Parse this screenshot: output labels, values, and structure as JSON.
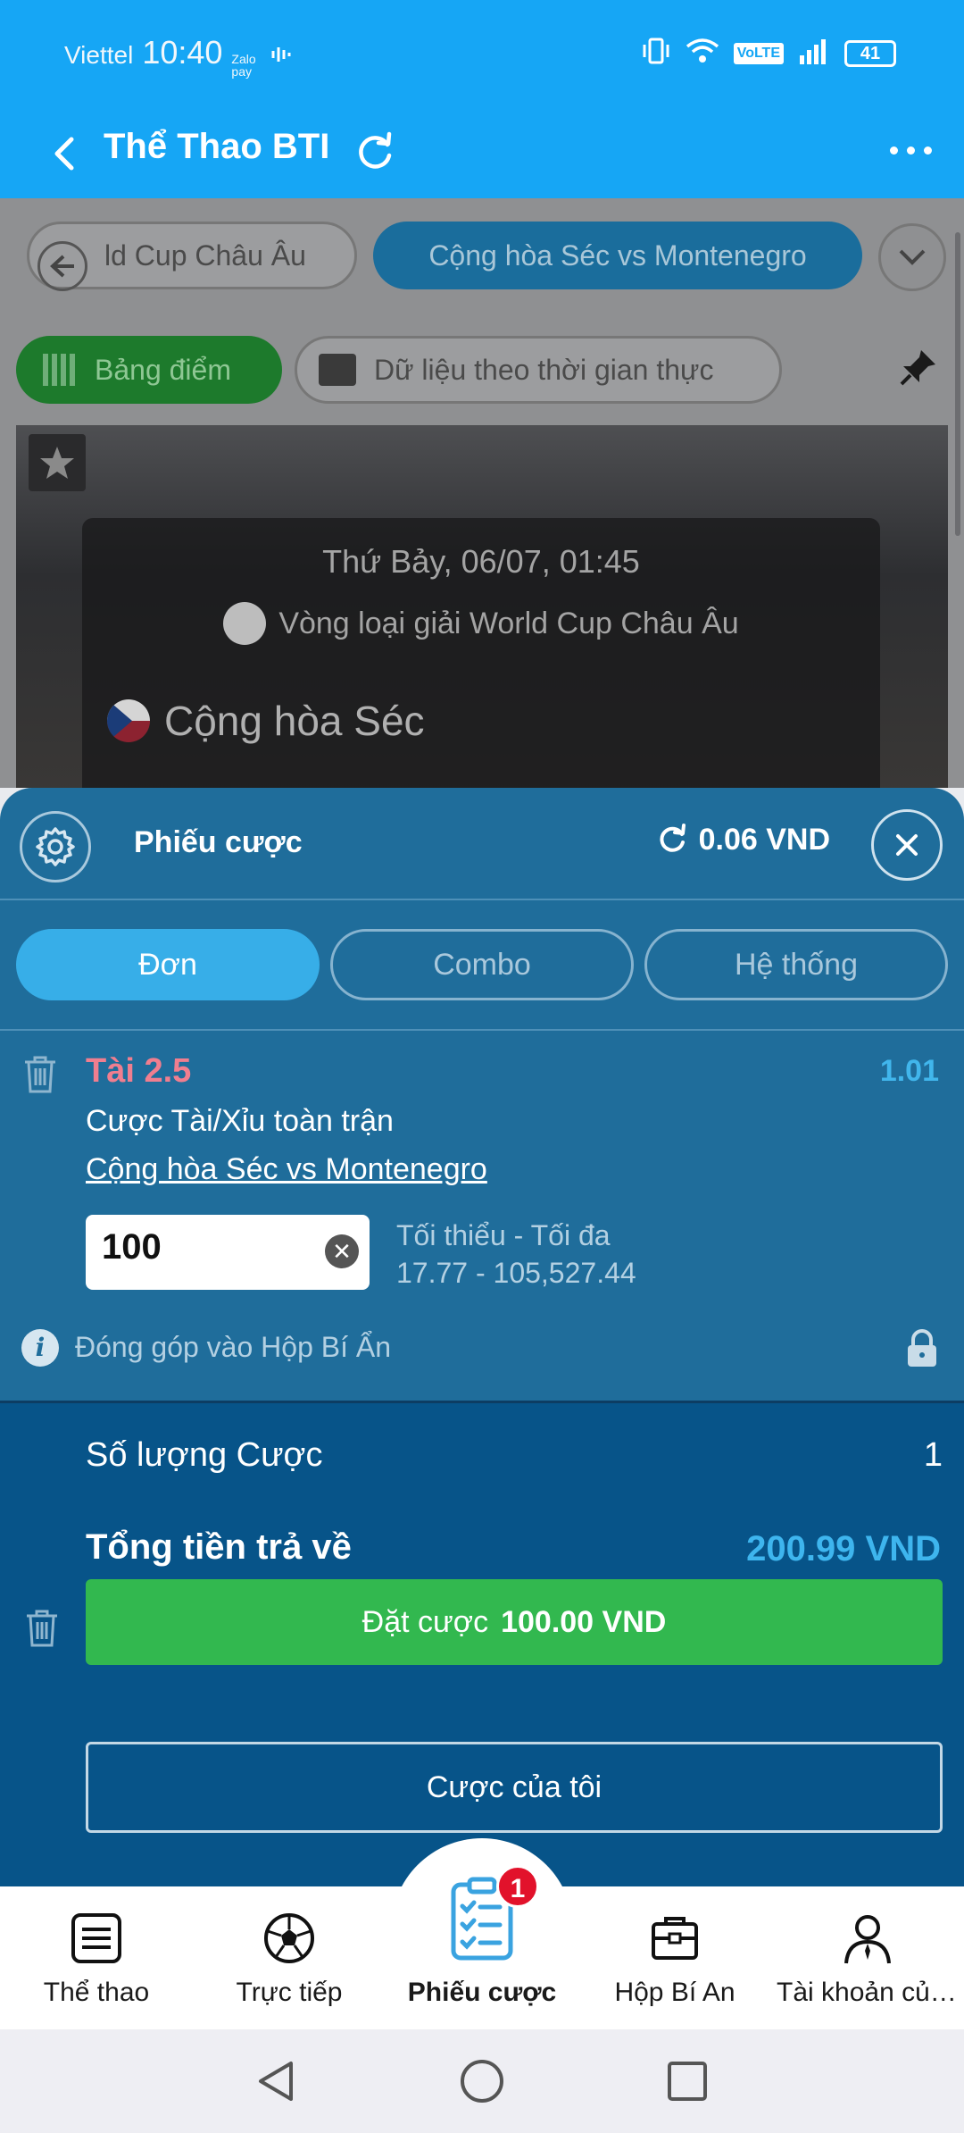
{
  "status_bar": {
    "carrier": "Viettel",
    "time": "10:40",
    "zalo": "Zalo pay",
    "network": "VoLTE",
    "battery": "41"
  },
  "header": {
    "title": "Thể Thao BTI"
  },
  "background": {
    "chips": [
      "ld Cup Châu Âu",
      "Cộng hòa Séc vs Montenegro"
    ],
    "scoreboard": "Bảng điểm",
    "live_data": "Dữ liệu theo thời gian thực",
    "date": "Thứ Bảy, 06/07, 01:45",
    "league": "Vòng loại giải World Cup Châu Âu",
    "team1": "Cộng hòa Séc"
  },
  "slip": {
    "title": "Phiếu cược",
    "balance": "0.06 VND",
    "tabs": [
      "Đơn",
      "Combo",
      "Hệ thống"
    ],
    "active_tab": "Đơn",
    "bet": {
      "selection": "Tài 2.5",
      "odds": "1.01",
      "market": "Cược Tài/Xỉu toàn trận",
      "event": "Cộng hòa Séc vs Montenegro",
      "stake": "100",
      "limits_label": "Tối thiểu - Tối đa",
      "limits_value": "17.77 - 105,527.44"
    },
    "contribution": "Đóng góp vào Hộp Bí Ẩn",
    "count_label": "Số lượng Cược",
    "count_value": "1",
    "return_label": "Tổng tiền trả về",
    "return_value": "200.99 VND",
    "place_label": "Đặt cược",
    "place_amount": "100.00 VND",
    "my_bets": "Cược của tôi"
  },
  "nav": {
    "items": [
      "Thể thao",
      "Trực tiếp",
      "Phiếu cược",
      "Hộp Bí An",
      "Tài khoản của ..."
    ],
    "badge": "1"
  },
  "colors": {
    "header_blue": "#16a6f5",
    "slip_blue": "#1f6d9b",
    "summary_blue": "#075489",
    "accent": "#37aee8",
    "place_green": "#32b84f",
    "selection_red": "#f07e8f"
  }
}
